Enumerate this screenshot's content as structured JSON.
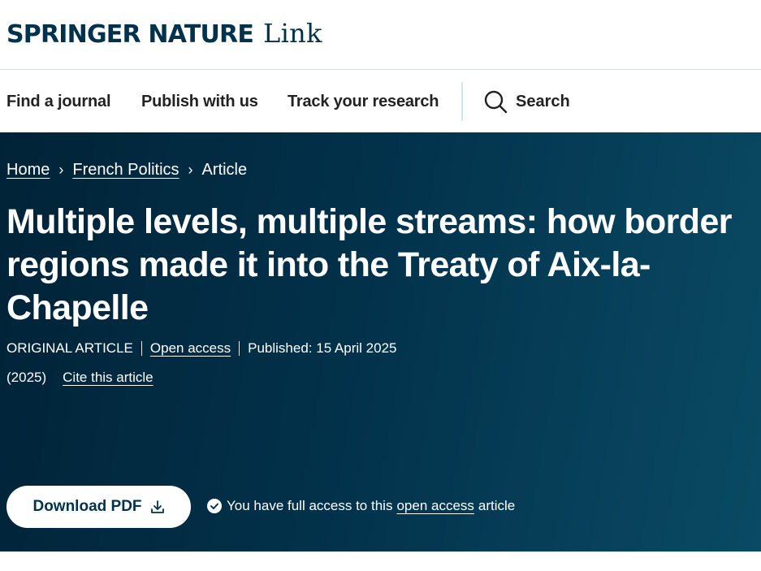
{
  "brand": {
    "name": "SPRINGER NATURE",
    "product": "Link"
  },
  "nav": {
    "find_journal": "Find a journal",
    "publish": "Publish with us",
    "track": "Track your research",
    "search": "Search"
  },
  "breadcrumb": {
    "home": "Home",
    "journal": "French Politics",
    "current": "Article"
  },
  "article": {
    "title": "Multiple levels, multiple streams: how border regions made it into the Treaty of Aix-la-Chapelle",
    "type": "ORIGINAL ARTICLE",
    "open_access": "Open access",
    "published": "Published: 15 April 2025",
    "year": "(2025)",
    "cite": "Cite this article"
  },
  "actions": {
    "download": "Download PDF",
    "access_prefix": "You have full access to this",
    "access_link": "open access",
    "access_suffix": "article"
  },
  "icons": {
    "search": "search-icon",
    "download": "download-icon",
    "check": "check-circle-icon",
    "chevron": "chevron-right-icon"
  },
  "colors": {
    "brand_navy": "#01324b",
    "hero_start": "#012337",
    "hero_end": "#0a4a64"
  }
}
